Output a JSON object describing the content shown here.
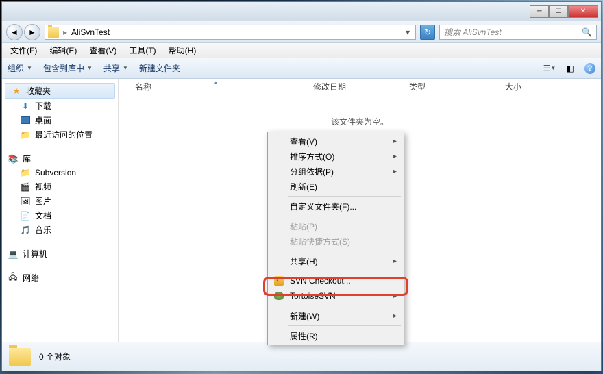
{
  "titlebar": {
    "min": "─",
    "max": "☐",
    "close": "✕"
  },
  "nav": {
    "path_sep": "▸",
    "path": "AliSvnTest",
    "dropdown": "▾",
    "refresh": "↻",
    "search_placeholder": "搜索 AliSvnTest",
    "search_icon": "🔍"
  },
  "menubar": [
    "文件(F)",
    "编辑(E)",
    "查看(V)",
    "工具(T)",
    "帮助(H)"
  ],
  "toolbar": {
    "organize": "组织",
    "organize_drop": "▼",
    "include": "包含到库中",
    "include_drop": "▼",
    "share": "共享",
    "share_drop": "▼",
    "newfolder": "新建文件夹",
    "view_drop": "▼",
    "help": "?"
  },
  "sidebar": {
    "favorites": "收藏夹",
    "downloads": "下载",
    "desktop": "桌面",
    "recent": "最近访问的位置",
    "libraries": "库",
    "subversion": "Subversion",
    "videos": "视频",
    "pictures": "图片",
    "documents": "文档",
    "music": "音乐",
    "computer": "计算机",
    "network": "网络"
  },
  "columns": {
    "name": "名称",
    "date": "修改日期",
    "type": "类型",
    "size": "大小",
    "sort": "▲"
  },
  "main": {
    "empty": "该文件夹为空。"
  },
  "status": {
    "count": "0 个对象"
  },
  "context": {
    "view": "查看(V)",
    "sort": "排序方式(O)",
    "group": "分组依据(P)",
    "refresh": "刷新(E)",
    "customize": "自定义文件夹(F)...",
    "paste": "粘贴(P)",
    "paste_shortcut": "粘贴快捷方式(S)",
    "share": "共享(H)",
    "svn_checkout": "SVN Checkout...",
    "tortoise": "TortoiseSVN",
    "new": "新建(W)",
    "properties": "属性(R)",
    "arrow": "▸"
  }
}
